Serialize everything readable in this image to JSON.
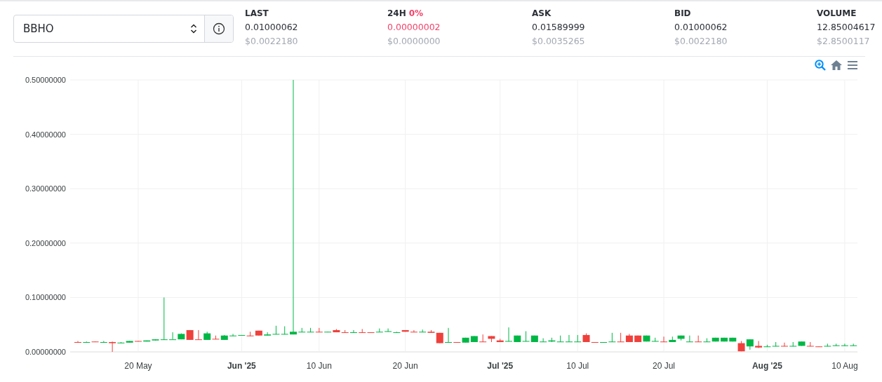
{
  "pair_select": {
    "value": "BBHO"
  },
  "stats": [
    {
      "label": "LAST",
      "value": "0.01000062",
      "usd": "$0.0022180"
    },
    {
      "label": "24H",
      "change": "0%",
      "value": "0.00000002",
      "usd": "$0.0000000",
      "negative": true
    },
    {
      "label": "ASK",
      "value": "0.01589999",
      "usd": "$0.0035265"
    },
    {
      "label": "BID",
      "value": "0.01000062",
      "usd": "$0.0022180"
    },
    {
      "label": "VOLUME",
      "value": "12.85004617",
      "usd": "$2.8500117"
    }
  ],
  "chart": {
    "kind": "picture",
    "y_axis_labels": [
      "0.50000000",
      "0.40000000",
      "0.30000000",
      "0.20000000",
      "0.10000000",
      "0.00000000"
    ],
    "x_axis_labels": [
      {
        "label": "20 May",
        "kind": "day"
      },
      {
        "label": "Jun '25",
        "kind": "month"
      },
      {
        "label": "10 Jun",
        "kind": "day"
      },
      {
        "label": "20 Jun",
        "kind": "day"
      },
      {
        "label": "Jul '25",
        "kind": "month"
      },
      {
        "label": "10 Jul",
        "kind": "day"
      },
      {
        "label": "20 Jul",
        "kind": "day"
      },
      {
        "label": "Aug '25",
        "kind": "month"
      },
      {
        "label": "10 Aug",
        "kind": "day"
      }
    ]
  }
}
